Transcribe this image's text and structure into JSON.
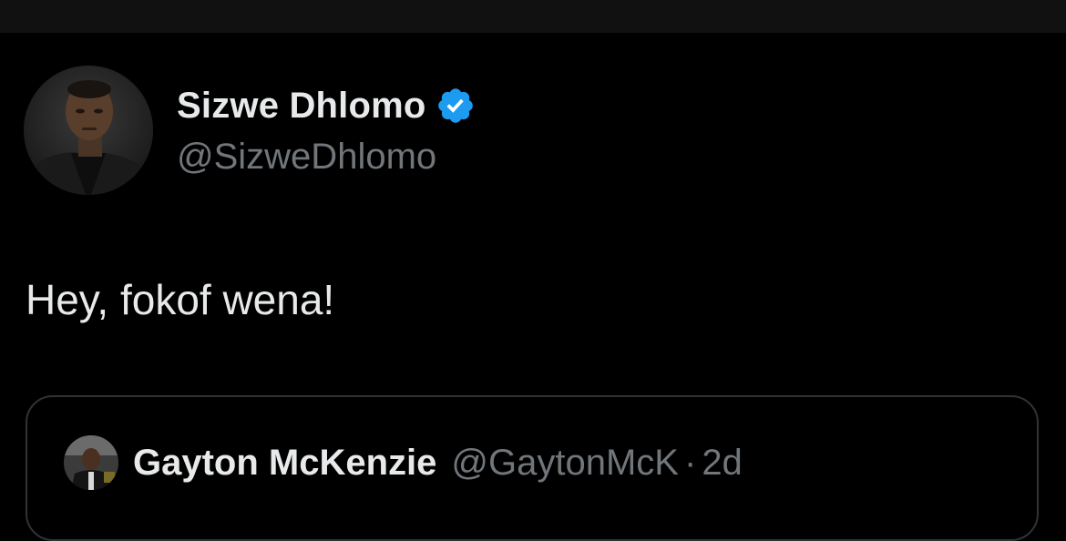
{
  "tweet": {
    "author": {
      "display_name": "Sizwe Dhlomo",
      "handle": "@SizweDhlomo",
      "verified": true,
      "avatar_icon": "profile-photo"
    },
    "text": "Hey, fokof wena!",
    "quote": {
      "author": {
        "display_name": "Gayton McKenzie",
        "handle": "@GaytonMcK",
        "avatar_icon": "profile-photo"
      },
      "separator": "·",
      "time": "2d"
    }
  },
  "colors": {
    "background": "#000000",
    "primary_text": "#e7e9ea",
    "secondary_text": "#71767b",
    "verified_badge": "#1d9bf0",
    "border": "#2f3336"
  }
}
